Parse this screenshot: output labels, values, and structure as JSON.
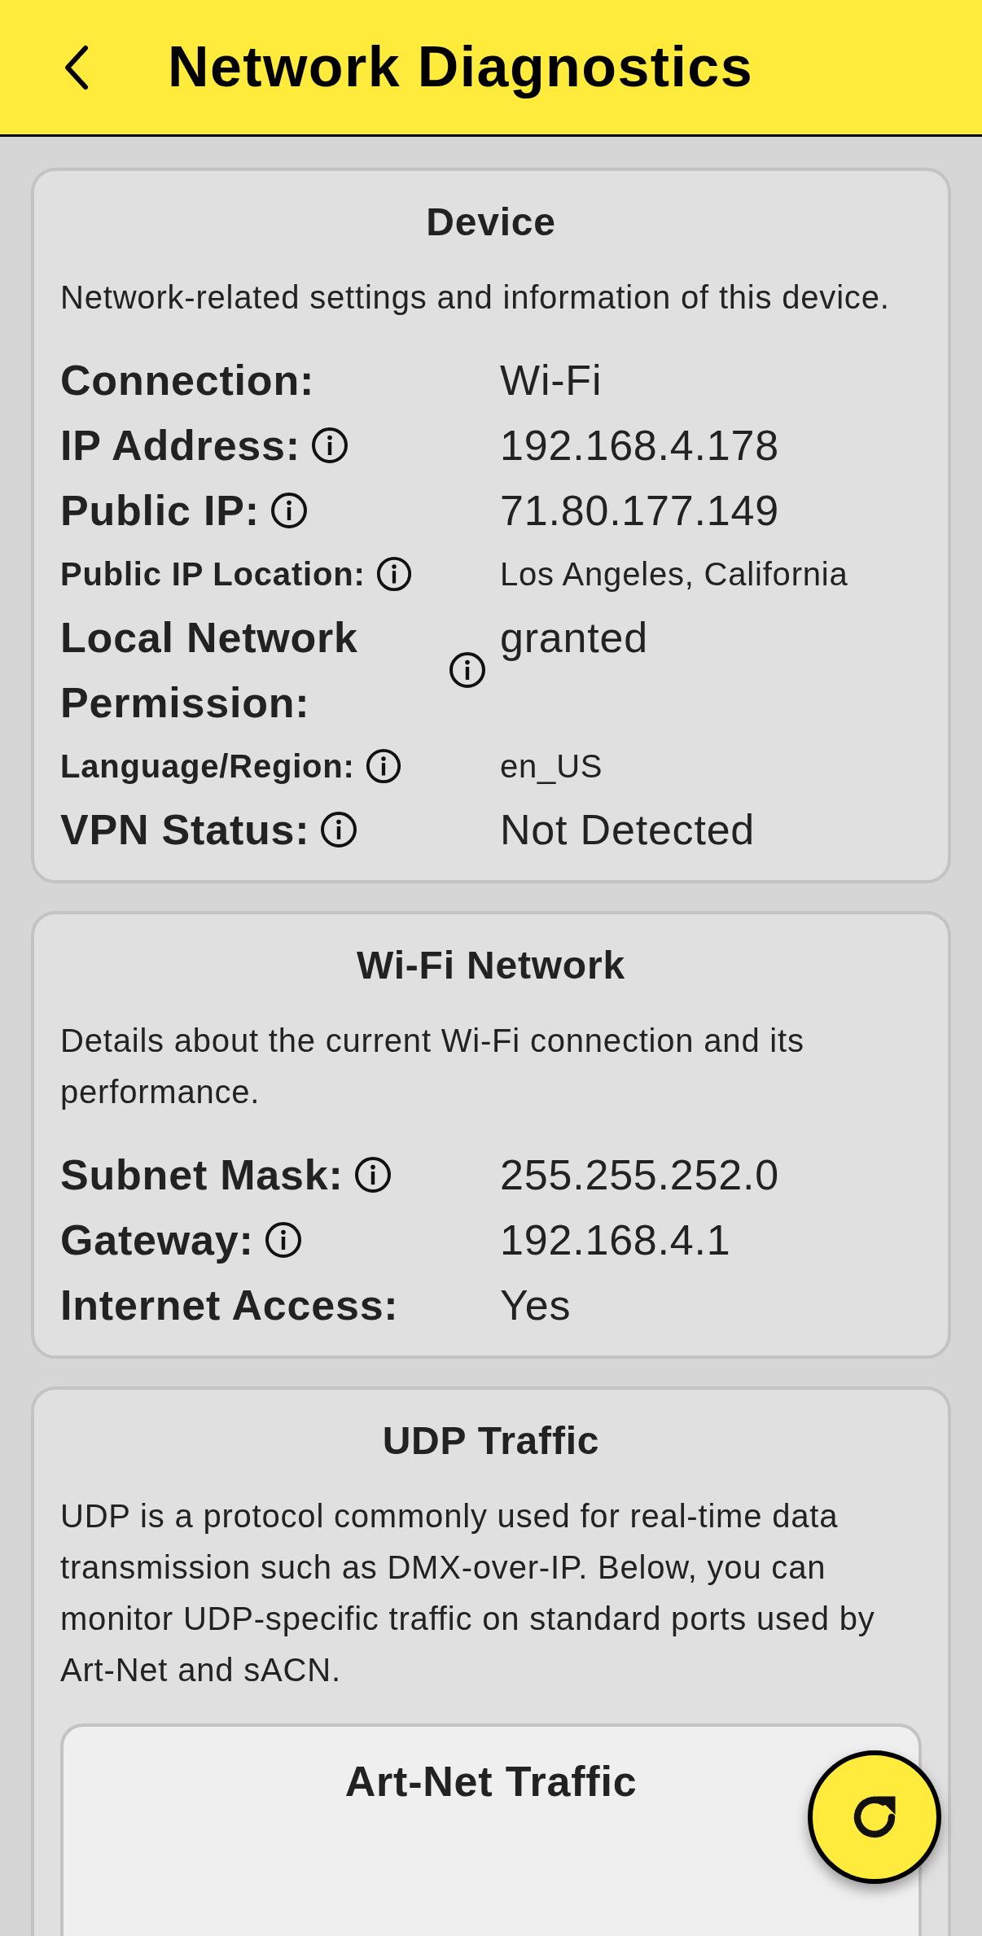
{
  "header": {
    "title": "Network Diagnostics"
  },
  "cards": [
    {
      "title": "Device",
      "description": "Network-related settings and information of this device.",
      "rows": [
        {
          "kind": "normal",
          "label": "Connection:",
          "info": false,
          "value": "Wi-Fi"
        },
        {
          "kind": "normal",
          "label": "IP Address:",
          "info": true,
          "value": "192.168.4.178"
        },
        {
          "kind": "normal",
          "label": "Public IP:",
          "info": true,
          "value": "71.80.177.149"
        },
        {
          "kind": "compact",
          "label": "Public IP Location:",
          "info": true,
          "value": "Los Angeles, California"
        },
        {
          "kind": "normal",
          "label": "Local Network Permission:",
          "info": true,
          "value": "granted"
        },
        {
          "kind": "compact",
          "label": "Language/Region:",
          "info": true,
          "value": "en_US"
        },
        {
          "kind": "normal",
          "label": "VPN Status:",
          "info": true,
          "value": "Not Detected"
        }
      ]
    },
    {
      "title": "Wi-Fi Network",
      "description": "Details about the current Wi-Fi connection and its performance.",
      "rows": [
        {
          "kind": "normal",
          "label": "Subnet Mask:",
          "info": true,
          "value": "255.255.252.0"
        },
        {
          "kind": "normal",
          "label": "Gateway:",
          "info": true,
          "value": "192.168.4.1"
        },
        {
          "kind": "normal",
          "label": "Internet Access:",
          "info": false,
          "value": "Yes"
        }
      ]
    },
    {
      "title": "UDP Traffic",
      "description": "UDP is a protocol commonly used for real-time data transmission such as DMX-over-IP. Below, you can monitor UDP-specific traffic on standard ports used by Art-Net and sACN.",
      "subcards": [
        {
          "title": "Art-Net Traffic"
        }
      ]
    }
  ]
}
